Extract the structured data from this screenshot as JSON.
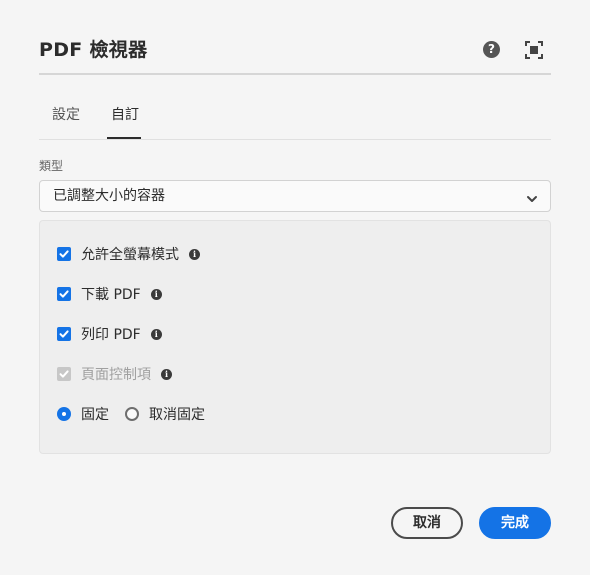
{
  "dialog": {
    "title": "PDF 檢視器",
    "help_icon": "help-circle-icon",
    "fullscreen_icon": "fullscreen-icon"
  },
  "tabs": [
    {
      "label": "設定",
      "selected": false
    },
    {
      "label": "自訂",
      "selected": true
    }
  ],
  "type_field": {
    "label": "類型",
    "value": "已調整大小的容器",
    "icon": "chevron-down-icon"
  },
  "options": {
    "allow_fullscreen": {
      "label": "允許全螢幕模式",
      "checked": true,
      "enabled": true
    },
    "download_pdf": {
      "label": "下載 PDF",
      "checked": true,
      "enabled": true
    },
    "print_pdf": {
      "label": "列印 PDF",
      "checked": true,
      "enabled": true
    },
    "page_controls": {
      "label": "頁面控制項",
      "checked": true,
      "enabled": false
    },
    "docking": {
      "fixed_label": "固定",
      "unfixed_label": "取消固定",
      "selected": "固定"
    }
  },
  "footer": {
    "cancel_label": "取消",
    "done_label": "完成"
  },
  "colors": {
    "accent": "#1473e6",
    "background": "#f5f5f5",
    "panel": "#eeeeee"
  }
}
